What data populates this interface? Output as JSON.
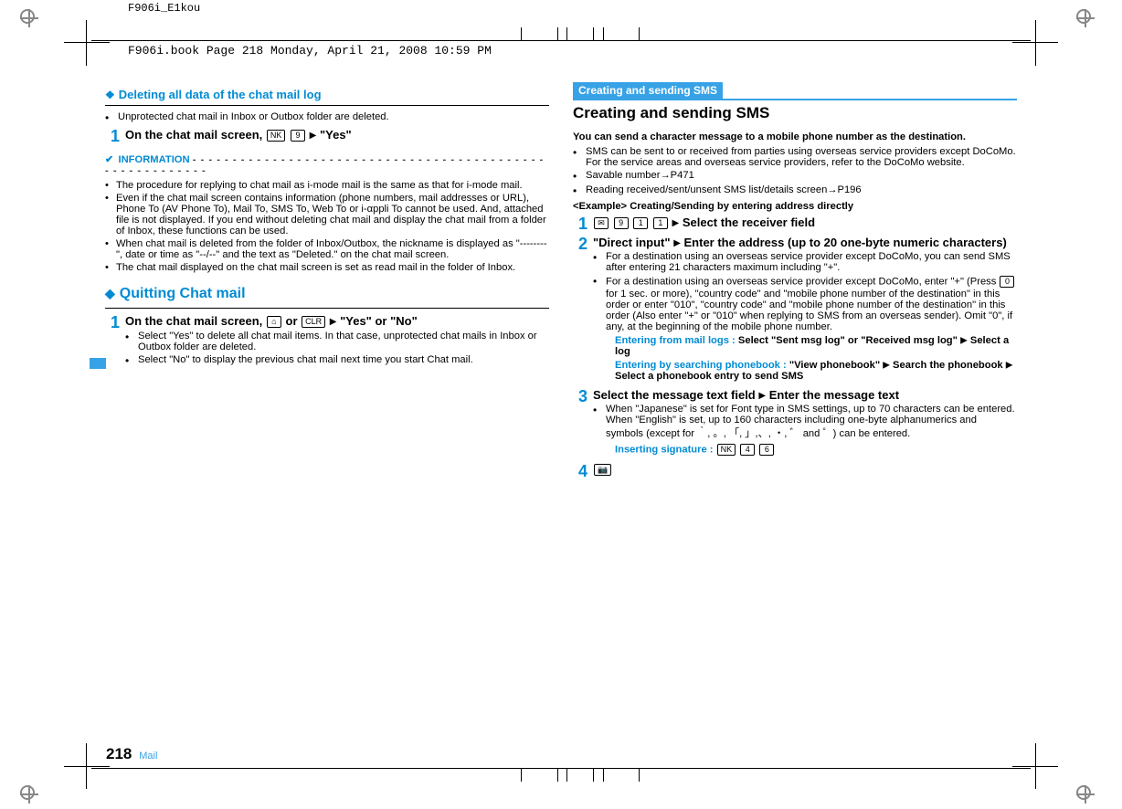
{
  "doc_id": "F906i_E1kou",
  "book_line": "F906i.book  Page 218  Monday, April 21, 2008  10:59 PM",
  "left": {
    "h1": "Deleting all data of the chat mail log",
    "bullet1": "Unprotected chat mail in Inbox or Outbox folder are deleted.",
    "step1_lead_a": "On the chat mail screen, ",
    "step1_key_nk": "NK",
    "step1_key_9": "9",
    "step1_tri": "▶",
    "step1_yes": "\"Yes\"",
    "info_label": "INFORMATION",
    "info_dashes": "- - - - - - - - - - - - - - - - - - - - - - - - - - - - - - - - - - - - - - - - - - - - - - - - - - - - - - - - -",
    "info": [
      "The procedure for replying to chat mail as i-mode mail is the same as that for i-mode mail.",
      "Even if the chat mail screen contains information (phone numbers, mail addresses or URL), Phone To (AV Phone To), Mail To, SMS To, Web To or i-αppli To cannot be used. And, attached file is not displayed. If you end without deleting chat mail and display the chat mail from a folder of Inbox, these functions can be used.",
      "When chat mail is deleted from the folder of Inbox/Outbox, the nickname is displayed as \"--------\", date or time as \"--/--\" and the text as \"Deleted.\" on the chat mail screen.",
      "The chat mail displayed on the chat mail screen is set as read mail in the folder of Inbox."
    ],
    "quitting": "Quitting Chat mail",
    "q_step1_lead_a": "On the chat mail screen, ",
    "q_step1_key_home": "⌂",
    "q_or": " or ",
    "q_step1_key_clr": "CLR",
    "q_tri": "▶",
    "q_yesno": "\"Yes\" or \"No\"",
    "q_bullets": [
      "Select \"Yes\" to delete all chat mail items. In that case, unprotected chat mails in Inbox or Outbox folder are deleted.",
      "Select \"No\" to display the previous chat mail next time you start Chat mail."
    ]
  },
  "right": {
    "sec_label": "Creating and sending SMS",
    "sec_title": "Creating and sending SMS",
    "p1": "You can send a character message to a mobile phone number as the destination.",
    "b1": "SMS can be sent to or received from parties using overseas service providers except DoCoMo. For the service areas and overseas service providers, refer to the DoCoMo website.",
    "b2": "Savable number→P471",
    "b3": "Reading received/sent/unsent SMS list/details screen→P196",
    "example": "<Example> Creating/Sending by entering address directly",
    "s1": {
      "num": "1",
      "k_mail": "✉",
      "k_9": "9",
      "k_1a": "1",
      "k_1b": "1",
      "tri": "▶",
      "tail": "Select the receiver field"
    },
    "s2": {
      "num": "2",
      "lead_a": "\"Direct input\"",
      "tri": "▶",
      "lead_b": "Enter the address (up to 20 one-byte numeric characters)",
      "bul1": "For a destination using an overseas service provider except DoCoMo, you can send SMS after entering 21 characters maximum including \"+\".",
      "bul2a": "For a destination using an overseas service provider except DoCoMo, enter \"+\" (Press ",
      "bul2_key0": "0",
      "bul2b": " for 1 sec. or more), \"country code\" and \"mobile phone number of the destination\" in this order or enter \"010\", \"country code\" and \"mobile phone number of the destination\" in this order (Also enter \"+\" or \"010\" when replying to SMS from an overseas sender). Omit \"0\", if any, at the beginning of the mobile phone number.",
      "ent_logs_lbl": "Entering from mail logs : ",
      "ent_logs_a": "Select \"Sent msg log\" or \"Received msg log\"",
      "ent_logs_tri": "▶",
      "ent_logs_b": "Select a log",
      "ent_pb_lbl": "Entering by searching phonebook : ",
      "ent_pb_a": "\"View phonebook\"",
      "ent_pb_tri1": "▶",
      "ent_pb_b": "Search the phonebook",
      "ent_pb_tri2": "▶",
      "ent_pb_c": "Select a phonebook entry to send SMS"
    },
    "s3": {
      "num": "3",
      "lead_a": "Select the message text field",
      "tri": "▶",
      "lead_b": "Enter the message text",
      "bul": "When \"Japanese\" is set for Font type in SMS settings, up to 70 characters can be entered. When \"English\" is set, up to 160 characters including one-byte alphanumerics and symbols (except for ｀, 。, 「, 」,、, ・, ゛ and ゜) can be entered.",
      "ins_lbl": "Inserting signature : ",
      "ins_k1": "NK",
      "ins_k2": "4",
      "ins_k3": "6"
    },
    "s4": {
      "num": "4",
      "k_cam": "📷"
    }
  },
  "footer": {
    "page": "218",
    "section": "Mail"
  }
}
